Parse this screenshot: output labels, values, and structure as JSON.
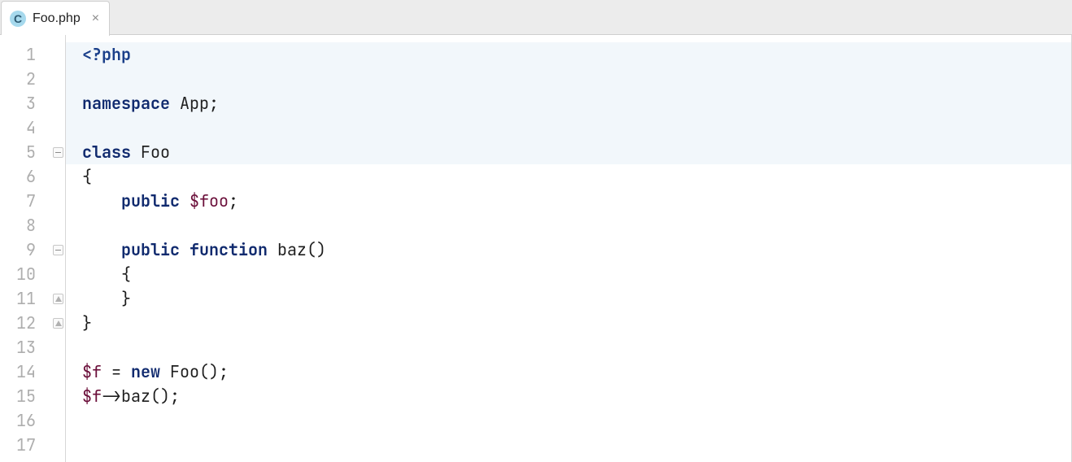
{
  "tab": {
    "icon_letter": "C",
    "filename": "Foo.php",
    "close_glyph": "×"
  },
  "gutter": {
    "lines": [
      "1",
      "2",
      "3",
      "4",
      "5",
      "6",
      "7",
      "8",
      "9",
      "10",
      "11",
      "12",
      "13",
      "14",
      "15",
      "16",
      "17"
    ],
    "folds": {
      "5": "open",
      "9": "open",
      "11": "close",
      "12": "close"
    }
  },
  "code": {
    "l1": {
      "band": true,
      "tokens": [
        {
          "cls": "tok-tag",
          "t": "<?php"
        }
      ],
      "sep": true
    },
    "l2": {
      "band": true,
      "tokens": []
    },
    "l3": {
      "band": true,
      "tokens": [
        {
          "cls": "tok-kw",
          "t": "namespace"
        },
        {
          "cls": "tok-plain",
          "t": " App;"
        }
      ],
      "sep": true
    },
    "l4": {
      "band": true,
      "tokens": []
    },
    "l5": {
      "band": true,
      "tokens": [
        {
          "cls": "tok-kw",
          "t": "class"
        },
        {
          "cls": "tok-plain",
          "t": " Foo"
        }
      ]
    },
    "l6": {
      "band": false,
      "tokens": [
        {
          "cls": "tok-plain",
          "t": "{"
        }
      ]
    },
    "l7": {
      "band": false,
      "tokens": [
        {
          "cls": "tok-plain",
          "t": "    "
        },
        {
          "cls": "tok-kw",
          "t": "public"
        },
        {
          "cls": "tok-plain",
          "t": " "
        },
        {
          "cls": "tok-var",
          "t": "$foo"
        },
        {
          "cls": "tok-plain",
          "t": ";"
        }
      ]
    },
    "l8": {
      "band": false,
      "tokens": []
    },
    "l9": {
      "band": false,
      "tokens": [
        {
          "cls": "tok-plain",
          "t": "    "
        },
        {
          "cls": "tok-kw",
          "t": "public"
        },
        {
          "cls": "tok-plain",
          "t": " "
        },
        {
          "cls": "tok-kw",
          "t": "function"
        },
        {
          "cls": "tok-plain",
          "t": " "
        },
        {
          "cls": "tok-func",
          "t": "baz"
        },
        {
          "cls": "tok-plain",
          "t": "()"
        }
      ]
    },
    "l10": {
      "band": false,
      "tokens": [
        {
          "cls": "tok-plain",
          "t": "    {"
        }
      ]
    },
    "l11": {
      "band": false,
      "tokens": [
        {
          "cls": "tok-plain",
          "t": "    }"
        }
      ]
    },
    "l12": {
      "band": false,
      "tokens": [
        {
          "cls": "tok-plain",
          "t": "}"
        }
      ]
    },
    "l13": {
      "band": false,
      "tokens": []
    },
    "l14": {
      "band": false,
      "tokens": [
        {
          "cls": "tok-var",
          "t": "$f"
        },
        {
          "cls": "tok-plain",
          "t": " = "
        },
        {
          "cls": "tok-kw",
          "t": "new"
        },
        {
          "cls": "tok-plain",
          "t": " Foo();"
        }
      ]
    },
    "l15": {
      "band": false,
      "tokens": [
        {
          "cls": "tok-var",
          "t": "$f"
        },
        {
          "cls": "tok-plain",
          "t": "->"
        },
        {
          "cls": "tok-func",
          "t": "baz"
        },
        {
          "cls": "tok-plain",
          "t": "();"
        }
      ]
    },
    "l16": {
      "band": false,
      "tokens": []
    },
    "l17": {
      "band": false,
      "tokens": []
    }
  }
}
